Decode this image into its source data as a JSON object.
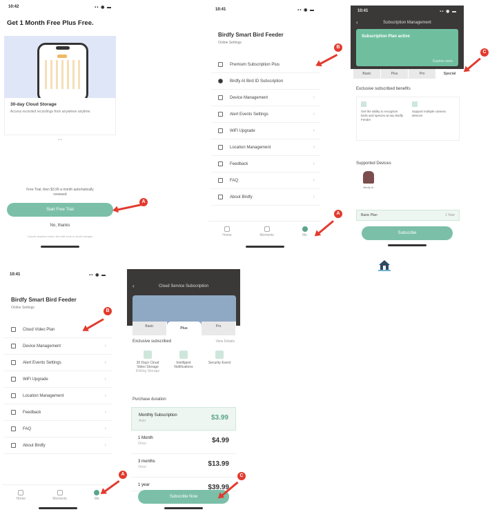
{
  "panel1": {
    "status_time": "10:42",
    "status_icons": "▪▪ ◉ ▬",
    "headline": "Get 1 Month Free Plus Free.",
    "feature_title": "30-day Cloud Storage",
    "feature_desc": "Access recorded recordings from anywhere anytime.",
    "dots": "• •",
    "fine_print": "Free Trial, then $3.99 a month automatically renewed",
    "cta_label": "Start Free Trial",
    "secondary_link": "No, thanks",
    "footer_text": "Cancel anytime before the trial ends to avoid charges",
    "marker": "A"
  },
  "panel2": {
    "status_time": "10:41",
    "status_icons": "▪▪ ◉ ▬",
    "device_title": "Birdfy Smart Bird Feeder",
    "device_sub": "Online  Settings",
    "menu": [
      {
        "label": "Premium Subscription Plus",
        "icon": "cloud-icon"
      },
      {
        "label": "Birdfy AI Bird ID Subscription",
        "icon": "bird-icon"
      },
      {
        "label": "Device Management",
        "icon": "device-icon"
      },
      {
        "label": "Alert Events Settings",
        "icon": "alert-icon"
      },
      {
        "label": "WiFi Upgrade",
        "icon": "wifi-icon"
      },
      {
        "label": "Location Management",
        "icon": "location-icon"
      },
      {
        "label": "Feedback",
        "icon": "feedback-icon"
      },
      {
        "label": "FAQ",
        "icon": "faq-icon"
      },
      {
        "label": "About Birdfy",
        "icon": "info-icon"
      }
    ],
    "tabs": [
      "Home",
      "Moments",
      "Me"
    ],
    "marker_top": "B",
    "marker_bottom": "A"
  },
  "panel3": {
    "status_time": "10:41",
    "status_icons": "▪▪ ◉ ▬",
    "header_title": "Subscription Management",
    "card_text": "Subscription Plan active",
    "card_sub": "Expires soon",
    "tabs": [
      "Basic",
      "Plus",
      "Pro",
      "Special"
    ],
    "section1": "Exclusive subscribed benefits",
    "benefit1": "Get the ability to recognize birds and species at any Birdfy Feeder",
    "benefit2": "Support multiple camera devices",
    "section2": "Supported Devices",
    "device_name": "Birdfy AI",
    "plan_row_label": "Basic Plan",
    "plan_row_value": "1 Year",
    "cta_label": "Subscribe",
    "marker": "C"
  },
  "panel4": {
    "status_time": "10:41",
    "status_icons": "▪▪ ◉ ▬",
    "device_title": "Birdfy Smart Bird Feeder",
    "device_sub": "Online  Settings",
    "menu": [
      {
        "label": "Cloud Video Plan",
        "icon": "cloud-icon"
      },
      {
        "label": "Device Management",
        "icon": "device-icon"
      },
      {
        "label": "Alert Events Settings",
        "icon": "alert-icon"
      },
      {
        "label": "WiFi Upgrade",
        "icon": "wifi-icon"
      },
      {
        "label": "Location Management",
        "icon": "location-icon"
      },
      {
        "label": "Feedback",
        "icon": "feedback-icon"
      },
      {
        "label": "FAQ",
        "icon": "faq-icon"
      },
      {
        "label": "About Birdfy",
        "icon": "info-icon"
      }
    ],
    "tabs": [
      "Home",
      "Moments",
      "Me"
    ],
    "marker_top": "B",
    "marker_bottom": "A"
  },
  "panel5": {
    "header_title": "Cloud Service Subscription",
    "tabs": [
      "Basic",
      "Plus",
      "Pro"
    ],
    "section1": "Exclusive subscribed",
    "section1_link": "View Details",
    "features": [
      {
        "label": "30 Days Cloud Video Storage",
        "sub": "Rolling Storage"
      },
      {
        "label": "Intelligent Notifications",
        "sub": ""
      },
      {
        "label": "Security Event",
        "sub": ""
      }
    ],
    "section2": "Purchase duration",
    "plans": [
      {
        "name": "Monthly Subscription",
        "sub": "Auto",
        "price": "$3.99"
      },
      {
        "name": "1 Month",
        "sub": "Once",
        "price": "$4.99"
      },
      {
        "name": "3 months",
        "sub": "Once",
        "price": "$13.99"
      },
      {
        "name": "1 year",
        "sub": "Once",
        "price": "$39.99"
      }
    ],
    "cta_label": "Subscribe Now",
    "marker": "C"
  },
  "watermark_icon": "house-logo"
}
